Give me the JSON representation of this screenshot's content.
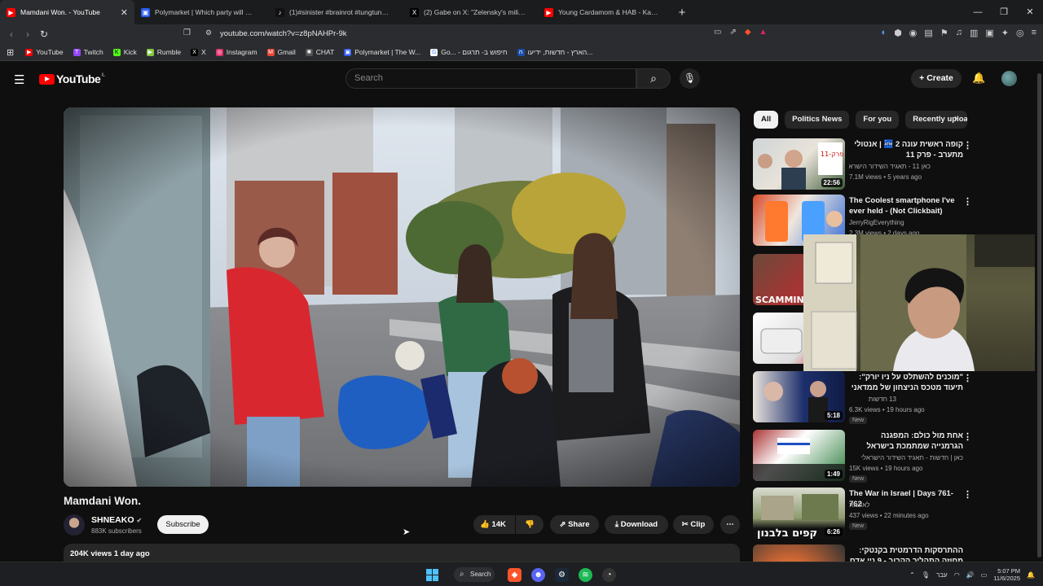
{
  "browser": {
    "tabs": [
      {
        "label": "Mamdani Won. - YouTube",
        "icon": "youtube-icon",
        "color": "#ff0000",
        "active": true
      },
      {
        "label": "Polymarket | Which party will win the",
        "icon": "polymarket-icon",
        "color": "#2b5cf0"
      },
      {
        "label": "(1)#sinister #brainrot #tungtungtung",
        "icon": "tiktok-icon",
        "color": "#111111"
      },
      {
        "label": "(2) Gabe on X: \"Zelensky's militants,",
        "icon": "x-icon",
        "color": "#000000"
      },
      {
        "label": "Young Cardamom & HAB - Kanda (C",
        "icon": "youtube-icon",
        "color": "#ff0000"
      }
    ],
    "url": "youtube.com/watch?v=z8pNAHPr-9k",
    "bookmarks": [
      {
        "label": "YouTube",
        "icon": "youtube-icon",
        "color": "#ff0000"
      },
      {
        "label": "Twitch",
        "icon": "twitch-icon",
        "color": "#9146ff"
      },
      {
        "label": "Kick",
        "icon": "kick-icon",
        "color": "#53fc18"
      },
      {
        "label": "Rumble",
        "icon": "rumble-icon",
        "color": "#85c742"
      },
      {
        "label": "X",
        "icon": "x-icon",
        "color": "#000000"
      },
      {
        "label": "Instagram",
        "icon": "instagram-icon",
        "color": "#e1306c"
      },
      {
        "label": "Gmail",
        "icon": "gmail-icon",
        "color": "#ea4335"
      },
      {
        "label": "CHAT",
        "icon": "chatgpt-icon",
        "color": "#555555"
      },
      {
        "label": "Polymarket | The W...",
        "icon": "polymarket-icon",
        "color": "#2b5cf0"
      },
      {
        "label": "Go... - חיפוש ב- תרגום",
        "icon": "google-icon",
        "color": "#4285f4"
      },
      {
        "label": "הארץ - חדשות, ידיעו...",
        "icon": "haaretz-icon",
        "color": "#1a4dad"
      }
    ]
  },
  "youtube": {
    "logo_text": "YouTube",
    "country": "IL",
    "search_placeholder": "Search",
    "create_label": "Create",
    "video": {
      "title": "Mamdani Won.",
      "channel": "SHNEAKO",
      "subscribers": "883K subscribers",
      "subscribe_label": "Subscribe",
      "likes": "14K",
      "share_label": "Share",
      "download_label": "Download",
      "clip_label": "Clip",
      "views_date": "204K views  1 day ago"
    },
    "chips": [
      "All",
      "Politics News",
      "For you",
      "Recently uploa"
    ],
    "recommendations": [
      {
        "title": "קופה ראשית עונה 2 🏧 | אנטולי מתערב - פרק 11",
        "channel": "כאן 11 - תאגיד השידור הישראלי",
        "meta": "7.1M views • 5 years ago",
        "duration": "22:56",
        "new": ""
      },
      {
        "title": "The Coolest smartphone I've ever held - (Not Clickbait)",
        "channel": "JerryRigEverything",
        "meta": "2.3M views • 2 days ago",
        "duration": "",
        "new": ""
      },
      {
        "title": "",
        "channel": "",
        "meta": "",
        "duration": "",
        "new": ""
      },
      {
        "title": "",
        "channel": "",
        "meta": "",
        "duration": "",
        "new": ""
      },
      {
        "title": "\"מוכנים להשתלט על ניו יורק\": תיעוד מטכס הניצחון של ממדאני",
        "channel": "13 חדשות",
        "meta": "6.3K views • 19 hours ago",
        "duration": "5:18",
        "new": "New"
      },
      {
        "title": "אחת מול כולם: המפגנה הגרמנייה שמתמכת בישראל זכתה בפרס ...",
        "channel": "כאן | חדשות - תאגיד השידור הישראלי",
        "meta": "15K views • 19 hours ago",
        "duration": "1:49",
        "new": "New"
      },
      {
        "title": "The War in Israel | Days 761-762",
        "channel": "לאונמת",
        "meta": "437 views • 22 minutes ago",
        "duration": "6:26",
        "new": "New"
      },
      {
        "title": "ההתרסקות הדרמטית בקנטקי: מחוזה התהליך הקרוב - 9 ניי אדם",
        "channel": "",
        "meta": "",
        "duration": "",
        "new": ""
      }
    ]
  },
  "taskbar": {
    "search_label": "Search",
    "lang": "עבר",
    "time": "5:07 PM",
    "date": "11/6/2025"
  }
}
